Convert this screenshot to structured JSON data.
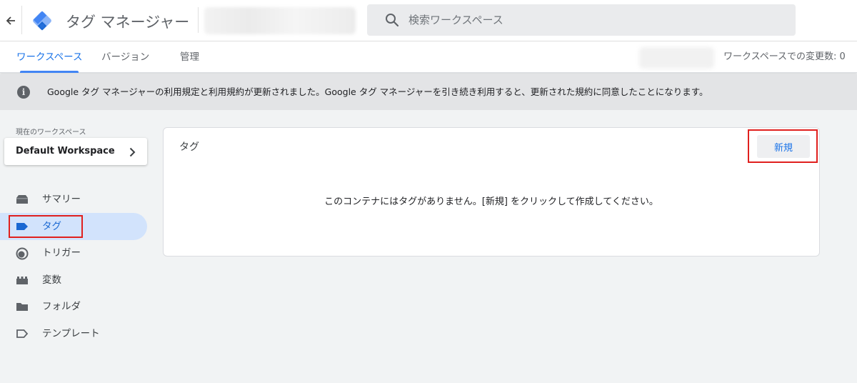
{
  "appbar": {
    "title": "タグ マネージャー",
    "back_icon": "arrow-back-icon",
    "logo_icon": "gtm-logo-icon",
    "search": {
      "placeholder": "検索ワークスペース",
      "icon": "search-icon"
    }
  },
  "tabs": [
    {
      "label": "ワークスペース",
      "active": true
    },
    {
      "label": "バージョン",
      "active": false
    },
    {
      "label": "管理",
      "active": false
    }
  ],
  "workspace_changes": "ワークスペースでの変更数: 0",
  "notice": {
    "icon": "info-icon",
    "text": "Google タグ マネージャーの利用規定と利用規約が更新されました。Google タグ マネージャーを引き続き利用すると、更新された規約に同意したことになります。"
  },
  "sidebar": {
    "workspace_label": "現在のワークスペース",
    "workspace_name": "Default Workspace",
    "items": [
      {
        "label": "サマリー",
        "icon": "summary-icon",
        "active": false
      },
      {
        "label": "タグ",
        "icon": "tag-icon",
        "active": true
      },
      {
        "label": "トリガー",
        "icon": "trigger-icon",
        "active": false
      },
      {
        "label": "変数",
        "icon": "variables-icon",
        "active": false
      },
      {
        "label": "フォルダ",
        "icon": "folder-icon",
        "active": false
      },
      {
        "label": "テンプレート",
        "icon": "template-icon",
        "active": false
      }
    ]
  },
  "main": {
    "card_title": "タグ",
    "new_button": "新規",
    "empty_message": "このコンテナにはタグがありません。[新規] をクリックして作成してください。"
  },
  "colors": {
    "accent": "#1a73e8",
    "highlight_box": "#e0201e",
    "active_nav_bg": "#d2e3fc",
    "notice_bg": "#e3e4e6"
  }
}
